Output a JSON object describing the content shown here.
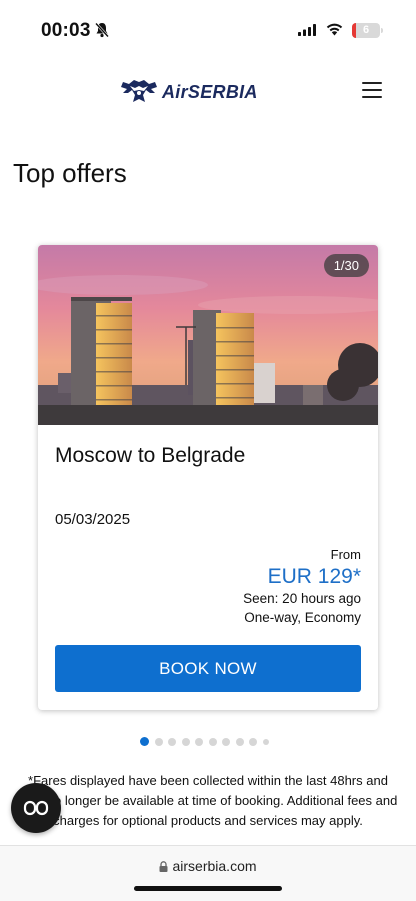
{
  "status": {
    "time": "00:03",
    "battery": "6"
  },
  "header": {
    "logo_text": "AirSERBIA",
    "menu_icon": "hamburger-menu-icon"
  },
  "page": {
    "title": "Top offers"
  },
  "offer": {
    "counter": "1/30",
    "route": "Moscow to Belgrade",
    "date": "05/03/2025",
    "from_label": "From",
    "price": "EUR 129*",
    "seen": "Seen: 20 hours ago",
    "fare_type": "One-way, Economy",
    "book_label": "BOOK NOW"
  },
  "carousel": {
    "total_dots": 10,
    "active_index": 0
  },
  "disclaimer": "*Fares displayed have been collected within the last 48hrs and may no longer be available at time of booking. Additional fees and charges for optional products and services may apply.",
  "browser": {
    "url": "airserbia.com"
  },
  "colors": {
    "accent": "#0e6fcf",
    "price": "#1e6fc7",
    "brand": "#1b2a5e"
  }
}
